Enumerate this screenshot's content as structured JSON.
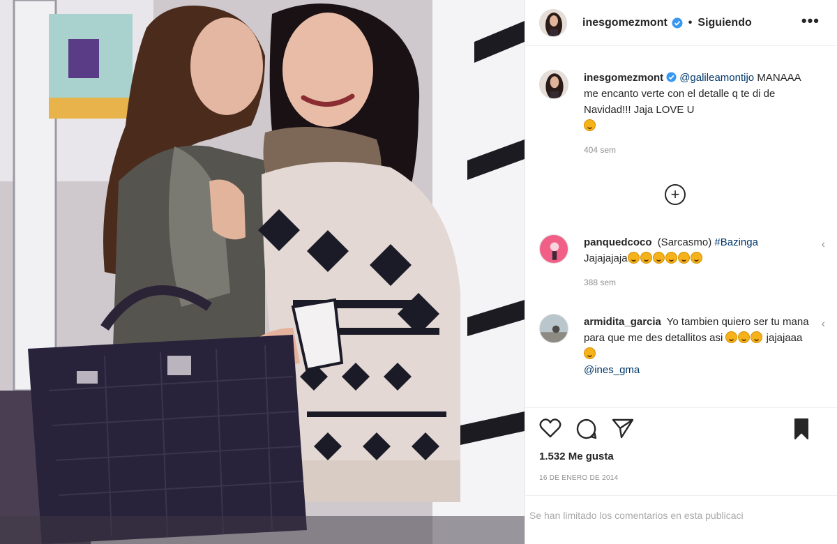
{
  "header": {
    "username": "inesgomezmont",
    "separator": "•",
    "follow_status": "Siguiendo",
    "more_icon": "more-options-icon"
  },
  "caption": {
    "username": "inesgomezmont",
    "mention": "@galileamontijo",
    "text": "MANAAA me encanto verte con el detalle q te di de Navidad!!! Jaja LOVE U",
    "emoji_count": 1,
    "time": "404 sem"
  },
  "load_more_icon": "+",
  "comments": [
    {
      "username": "panquedcoco",
      "text_before": "(Sarcasmo)",
      "hashtag": "#Bazinga",
      "text_after": "Jajajajaja",
      "emoji_count": 6,
      "time": "388 sem"
    },
    {
      "username": "armidita_garcia",
      "text": "Yo tambien quiero ser tu mana para que me des detallitos asi",
      "emoji_count": 3,
      "text_after": "jajajaaa",
      "emoji_count_after": 1,
      "mention": "@ines_gma"
    }
  ],
  "actions": {
    "icons": [
      "heart-icon",
      "comment-icon",
      "share-icon",
      "bookmark-icon"
    ]
  },
  "likes": "1.532 Me gusta",
  "date": "16 DE ENERO DE 2014",
  "comments_limited": "Se han limitado los comentarios en esta publicaci",
  "colors": {
    "verified_blue": "#3897f0",
    "link_blue": "#00376b",
    "muted": "#8e8e8e"
  }
}
